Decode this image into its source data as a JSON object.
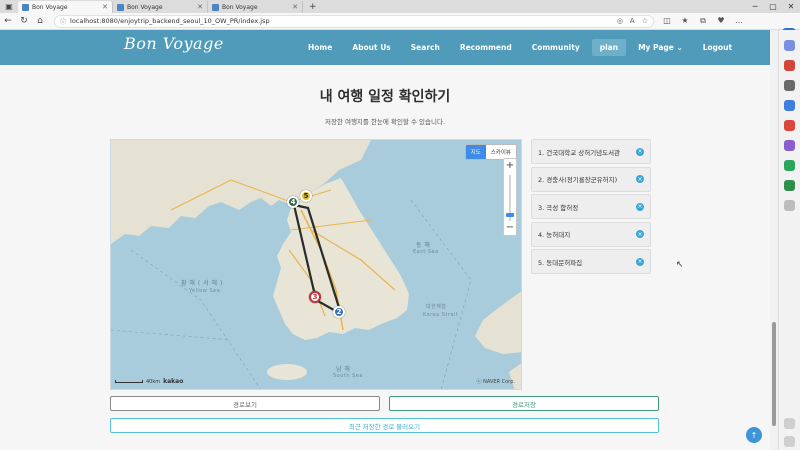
{
  "browser": {
    "tabs": [
      {
        "label": "Bon Voyage",
        "active": true
      },
      {
        "label": "Bon Voyage",
        "active": false
      },
      {
        "label": "Bon Voyage",
        "active": false
      }
    ],
    "url": "localhost:8080/enjoytrip_backend_seoul_10_OW_PR/index.jsp"
  },
  "site": {
    "brand": "Bon Voyage",
    "nav": [
      {
        "label": "Home"
      },
      {
        "label": "About Us"
      },
      {
        "label": "Search"
      },
      {
        "label": "Recommend"
      },
      {
        "label": "Community"
      },
      {
        "label": "plan",
        "active": true
      },
      {
        "label": "My Page ⌄"
      },
      {
        "label": "Logout"
      }
    ]
  },
  "page": {
    "title": "내 여행 일정 확인하기",
    "subtitle": "저장한 여행지를 한눈에 확인할 수 있습니다."
  },
  "map": {
    "type_buttons": [
      "지도",
      "스카이뷰"
    ],
    "scale_label": "40km",
    "provider": "kakao",
    "copyright": "ⓒ NAVER Corp.",
    "labels": {
      "east_sea_kr": "동 해",
      "east_sea_en": "East Sea",
      "yellow_sea_kr": "황 해 ( 서 해 )",
      "yellow_sea_en": "Yellow Sea",
      "korea_strait_kr": "대한해협",
      "korea_strait_en": "Korea Strait",
      "south_sea_kr": "남 해",
      "south_sea_en": "South Sea"
    },
    "markers": [
      {
        "number": "2",
        "color": "#3a6fbf"
      },
      {
        "number": "3",
        "color": "#c8313a"
      },
      {
        "number": "4",
        "color": "#2f6e45"
      },
      {
        "number": "5",
        "color": "#e2c12a"
      }
    ]
  },
  "route": {
    "items": [
      {
        "label": "1. 건국대학교 상허기념도서관"
      },
      {
        "label": "2. 경충사(정기룡장군유허지)"
      },
      {
        "label": "3. 곡성 함허정"
      },
      {
        "label": "4. 농허대지"
      },
      {
        "label": "5. 동대문허파집"
      }
    ],
    "delete_icon": "×"
  },
  "buttons": {
    "view": "경로보기",
    "save": "경로저장",
    "load": "최근 저장한 경로 불러오기"
  }
}
